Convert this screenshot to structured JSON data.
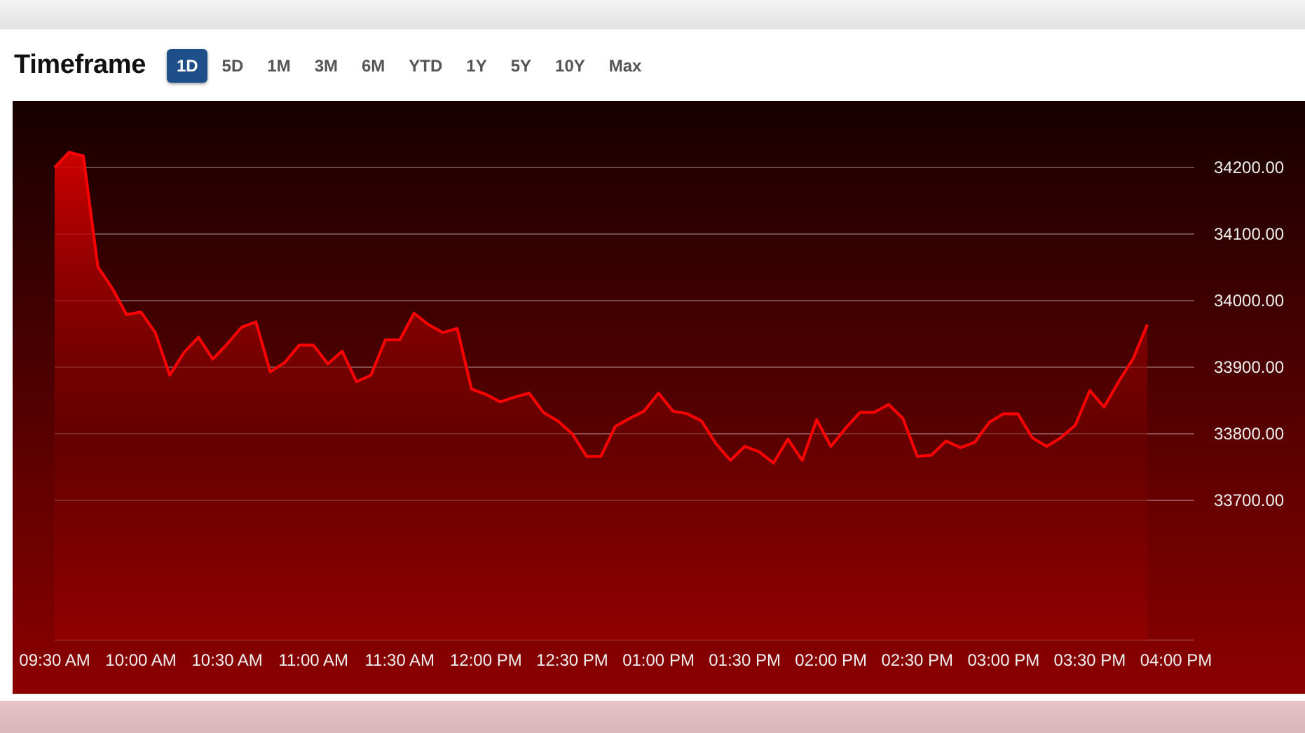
{
  "header": {
    "title": "Timeframe",
    "tabs": [
      {
        "label": "1D",
        "selected": true
      },
      {
        "label": "5D",
        "selected": false
      },
      {
        "label": "1M",
        "selected": false
      },
      {
        "label": "3M",
        "selected": false
      },
      {
        "label": "6M",
        "selected": false
      },
      {
        "label": "YTD",
        "selected": false
      },
      {
        "label": "1Y",
        "selected": false
      },
      {
        "label": "5Y",
        "selected": false
      },
      {
        "label": "10Y",
        "selected": false
      },
      {
        "label": "Max",
        "selected": false
      }
    ]
  },
  "chart": {
    "chart_data": {
      "type": "area",
      "grid": true,
      "categories": [
        "09:30 AM",
        null,
        null,
        null,
        null,
        null,
        "10:00 AM",
        null,
        null,
        null,
        null,
        null,
        "10:30 AM",
        null,
        null,
        null,
        null,
        null,
        "11:00 AM",
        null,
        null,
        null,
        null,
        null,
        "11:30 AM",
        null,
        null,
        null,
        null,
        null,
        "12:00 PM",
        null,
        null,
        null,
        null,
        null,
        "12:30 PM",
        null,
        null,
        null,
        null,
        null,
        "01:00 PM",
        null,
        null,
        null,
        null,
        null,
        "01:30 PM",
        null,
        null,
        null,
        null,
        null,
        "02:00 PM",
        null,
        null,
        null,
        null,
        null,
        "02:30 PM",
        null,
        null,
        null,
        null,
        null,
        "03:00 PM",
        null,
        null,
        null,
        null,
        null,
        "03:30 PM",
        null,
        null,
        null,
        null,
        null,
        "04:00 PM"
      ],
      "series": [
        {
          "color": "#ff0000",
          "values": [
            34200,
            34223,
            34217,
            34051,
            34019,
            33979,
            33983,
            33952,
            33888,
            33922,
            33945,
            33912,
            33935,
            33960,
            33968,
            33893,
            33907,
            33933,
            33933,
            33905,
            33924,
            33878,
            33888,
            33941,
            33941,
            33981,
            33964,
            33952,
            33958,
            33867,
            33859,
            33848,
            33855,
            33861,
            33832,
            33819,
            33800,
            33766,
            33766,
            33811,
            33823,
            33834,
            33861,
            33834,
            33830,
            33819,
            33785,
            33760,
            33781,
            33773,
            33756,
            33792,
            33760,
            33821,
            33781,
            33808,
            33832,
            33832,
            33844,
            33823,
            33766,
            33768,
            33789,
            33779,
            33787,
            33817,
            33830,
            33830,
            33794,
            33781,
            33794,
            33813,
            33865,
            33840,
            33878,
            33912,
            33964,
            null,
            null
          ]
        }
      ],
      "ylim": [
        33490,
        34300
      ],
      "yticks": [
        {
          "value": 34200,
          "label": "34200.00"
        },
        {
          "value": 34100,
          "label": "34100.00"
        },
        {
          "value": 34000,
          "label": "34000.00"
        },
        {
          "value": 33900,
          "label": "33900.00"
        },
        {
          "value": 33800,
          "label": "33800.00"
        },
        {
          "value": 33700,
          "label": "33700.00"
        }
      ]
    }
  }
}
